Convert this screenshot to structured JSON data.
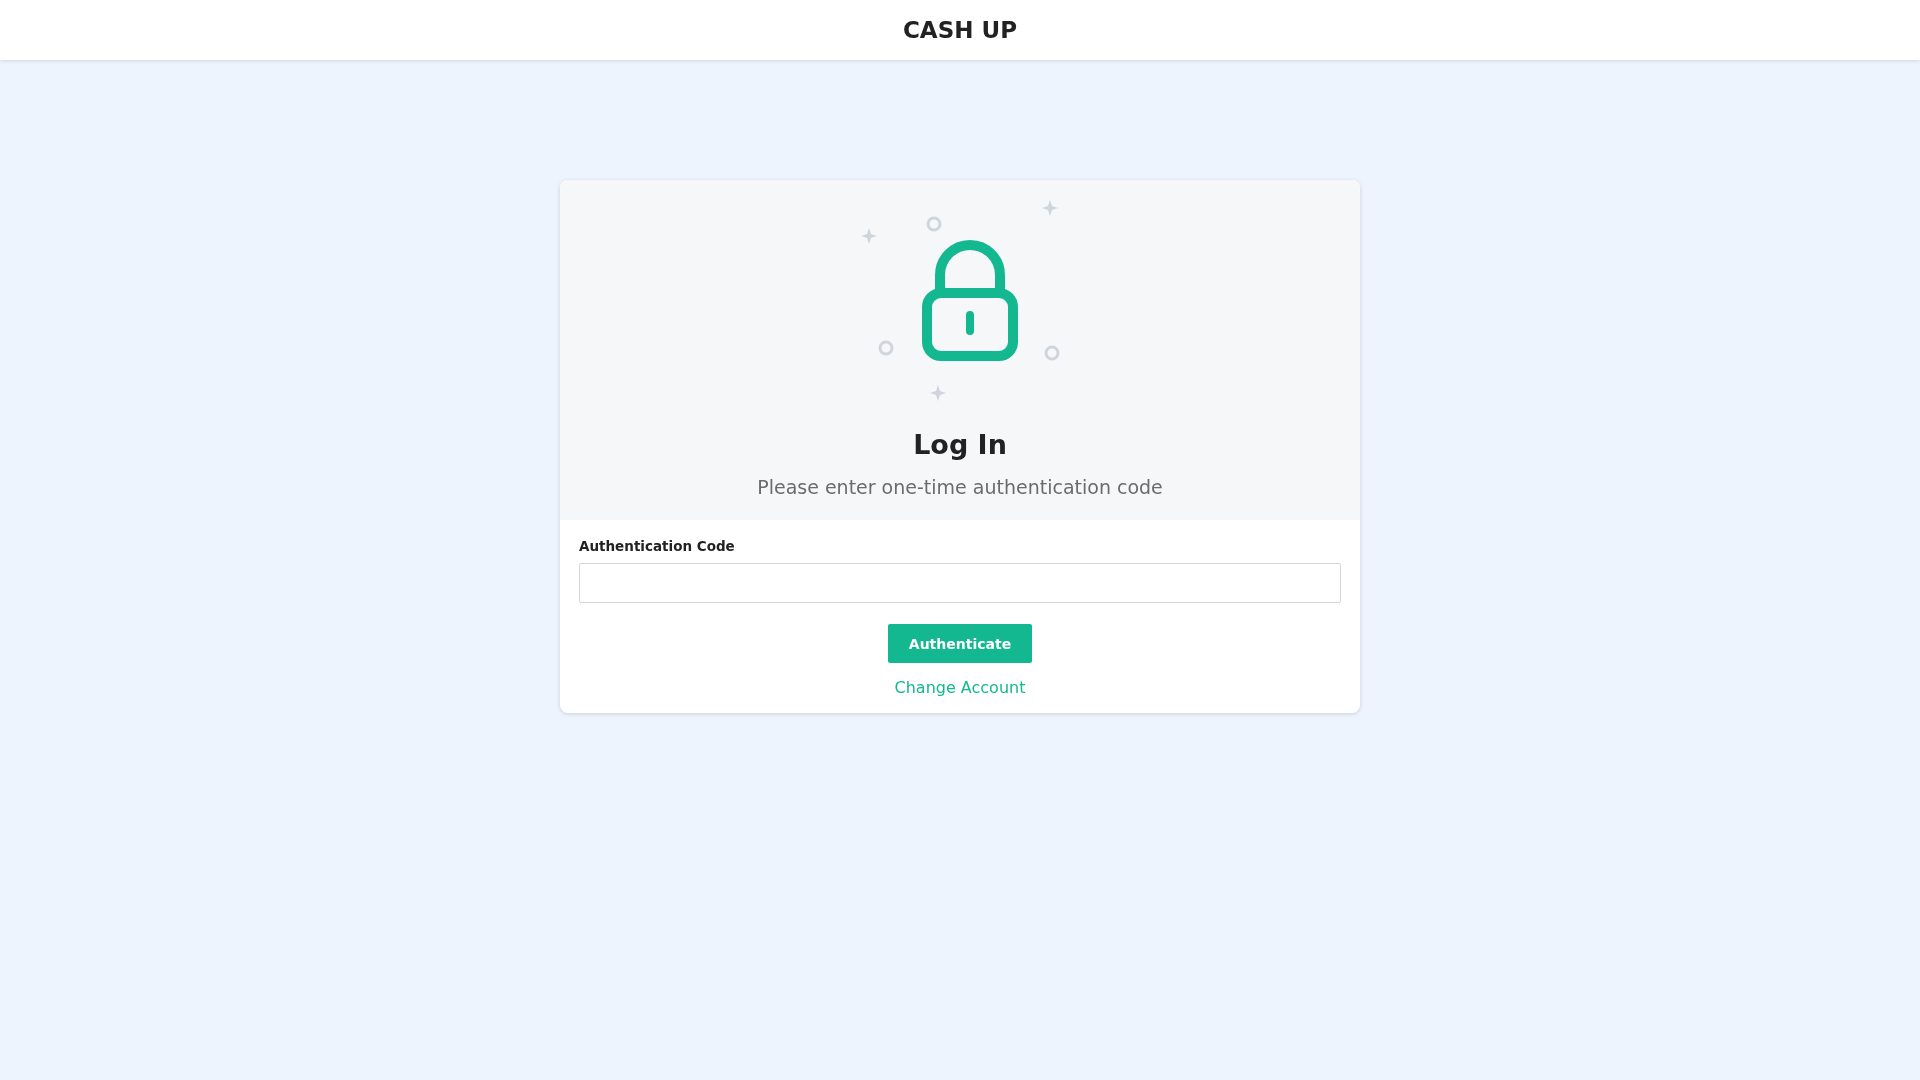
{
  "header": {
    "title": "CASH UP"
  },
  "login": {
    "heading": "Log In",
    "subtitle": "Please enter one-time authentication code",
    "field": {
      "label": "Authentication Code"
    },
    "button": "Authenticate",
    "link": "Change Account"
  }
}
